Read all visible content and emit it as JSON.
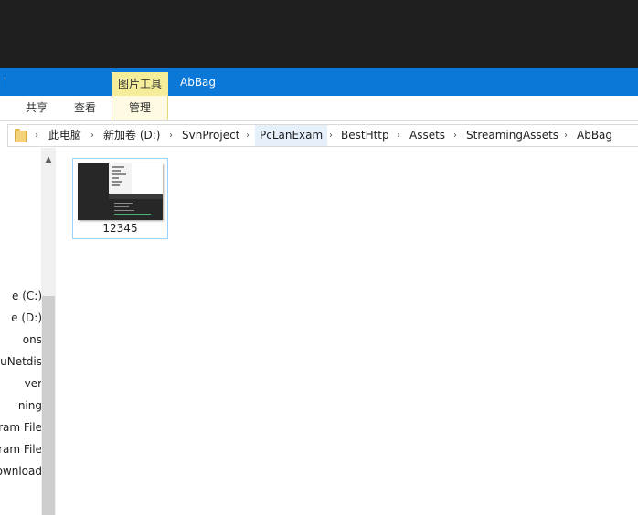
{
  "title_bar": {
    "context_tab_group": "图片工具",
    "window_title": "AbBag"
  },
  "ribbon": {
    "tabs": [
      {
        "label": "共享"
      },
      {
        "label": "查看"
      },
      {
        "label": "管理",
        "active": true
      }
    ],
    "context_color": "#f5ed9a",
    "accent_color": "#0b78d7"
  },
  "address_bar": {
    "folder_icon": "folder-icon",
    "separator": "›",
    "crumbs": [
      "此电脑",
      "新加卷 (D:)",
      "SvnProject",
      "PcLanExam",
      "BestHttp",
      "Assets",
      "StreamingAssets",
      "AbBag"
    ]
  },
  "nav_pane": {
    "items": [
      "e (C:)",
      "e (D:)",
      "ons",
      "uNetdis",
      "ver",
      "ning",
      "gram File",
      "gram File",
      "ownload"
    ],
    "scroll_up_icon": "chevron-up-icon"
  },
  "files": [
    {
      "name": "12345",
      "type": "image-thumbnail",
      "selected": true
    }
  ]
}
